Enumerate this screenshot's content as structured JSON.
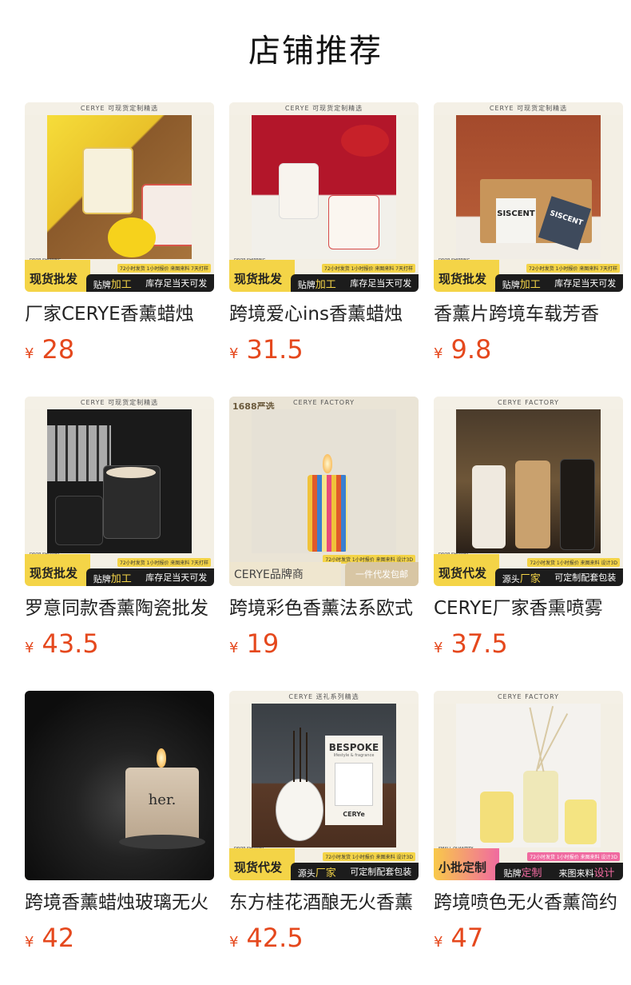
{
  "page": {
    "title": "店铺推荐"
  },
  "products": [
    {
      "name": "厂家CERYE香薰蜡烛",
      "price": "28",
      "currency": "¥",
      "banner_top": "CERYE 可现货定制精选",
      "badge_left": "现货批发",
      "badge_right": [
        "贴牌",
        "加工",
        "库存足当天可发"
      ],
      "note": "72小时发货 1小时报价 来图来料 7天打样",
      "ds": "DROP-SHIPPING"
    },
    {
      "name": "跨境爱心ins香薰蜡烛",
      "price": "31.5",
      "currency": "¥",
      "banner_top": "CERYE 可现货定制精选",
      "badge_left": "现货批发",
      "badge_right": [
        "贴牌",
        "加工",
        "库存足当天可发"
      ],
      "note": "72小时发货 1小时报价 来图来料 7天打样",
      "ds": "DROP-SHIPPING"
    },
    {
      "name": "香薰片跨境车载芳香",
      "price": "9.8",
      "currency": "¥",
      "banner_top": "CERYE 可现货定制精选",
      "badge_left": "现货批发",
      "badge_right": [
        "贴牌",
        "加工",
        "库存足当天可发"
      ],
      "note": "72小时发货 1小时报价 来图来料 7天打样",
      "ds": "DROP-SHIPPING",
      "card_labels": [
        "SISCENT",
        "SISCENT"
      ]
    },
    {
      "name": "罗意同款香薰陶瓷批发",
      "price": "43.5",
      "currency": "¥",
      "banner_top": "CERYE 可现货定制精选",
      "badge_left": "现货批发",
      "badge_right": [
        "贴牌",
        "加工",
        "库存足当天可发"
      ],
      "note": "72小时发货 1小时报价 来图来料 7天打样",
      "ds": "DROP-SHIPPING"
    },
    {
      "name": "跨境彩色香薰法系欧式",
      "price": "19",
      "currency": "¥",
      "banner_top": "CERYE FACTORY",
      "corner_tag": "1688严选",
      "badge_left": "CERYE品牌商",
      "badge_right": [
        "一件代发包邮"
      ],
      "note": "72小时发货 1小时报价 来图来料 设计3D"
    },
    {
      "name": "CERYE厂家香熏喷雾",
      "price": "37.5",
      "currency": "¥",
      "banner_top": "CERYE FACTORY",
      "badge_left": "现货代发",
      "badge_right": [
        "源头",
        "厂家",
        "可定制配套包装"
      ],
      "note": "72小时发货 1小时报价 来图来料 设计3D",
      "ds": "DROP-SHIPPING"
    },
    {
      "name": "跨境香薰蜡烛玻璃无火",
      "price": "42",
      "currency": "¥",
      "jar_label": "her."
    },
    {
      "name": "东方桂花酒酿无火香薰",
      "price": "42.5",
      "currency": "¥",
      "banner_top": "CERYE 送礼系列精选",
      "badge_left": "现货代发",
      "badge_right": [
        "源头",
        "厂家",
        "可定制配套包装"
      ],
      "note": "72小时发货 1小时报价 来图来料 设计3D",
      "ds": "DROP-SHIPPING",
      "box_title": "BESPOKE",
      "box_subtitle": "lifestyle & fragrance",
      "box_brand": "CERYe"
    },
    {
      "name": "跨境喷色无火香薰简约",
      "price": "47",
      "currency": "¥",
      "banner_top": "CERYE FACTORY",
      "badge_left": "小批定制",
      "badge_right": [
        "贴牌",
        "定制",
        "来图来料",
        "设计"
      ],
      "note": "72小时发货 1小时报价 来图来料 设计3D",
      "ds": "SMALL QUANTITY"
    }
  ]
}
